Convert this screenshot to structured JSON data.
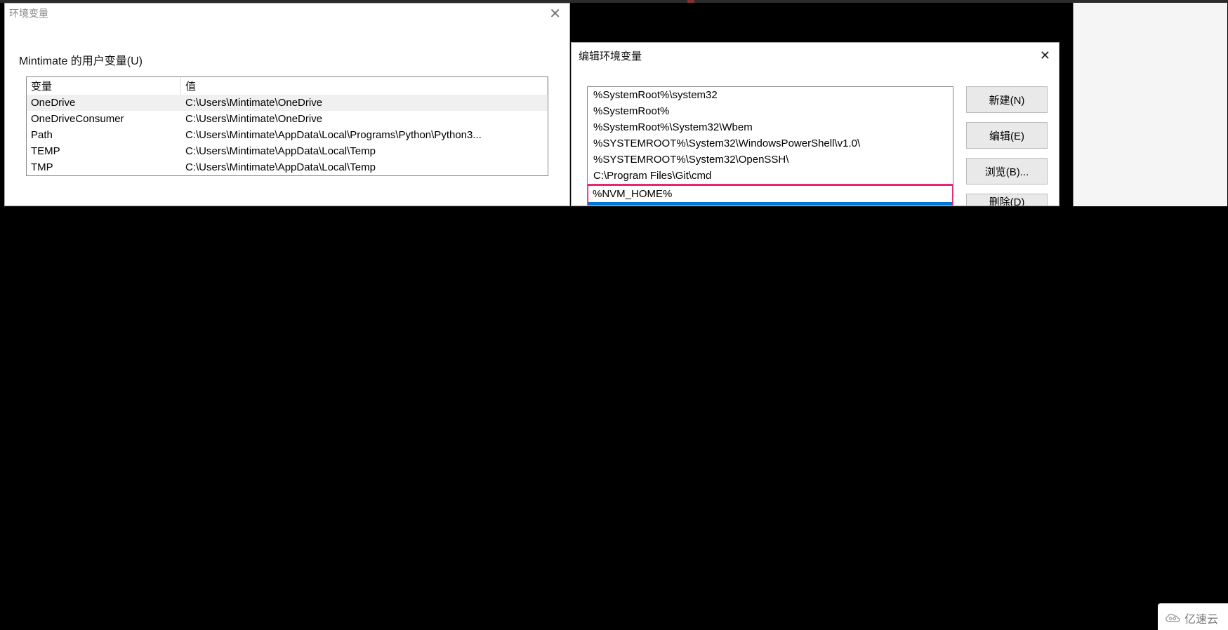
{
  "env_window": {
    "title": "环境变量",
    "section_label": "Mintimate 的用户变量(U)",
    "columns": {
      "var": "变量",
      "val": "值"
    },
    "rows": [
      {
        "name": "OneDrive",
        "value": "C:\\Users\\Mintimate\\OneDrive",
        "selected": true
      },
      {
        "name": "OneDriveConsumer",
        "value": "C:\\Users\\Mintimate\\OneDrive",
        "selected": false
      },
      {
        "name": "Path",
        "value": "C:\\Users\\Mintimate\\AppData\\Local\\Programs\\Python\\Python3...",
        "selected": false
      },
      {
        "name": "TEMP",
        "value": "C:\\Users\\Mintimate\\AppData\\Local\\Temp",
        "selected": false
      },
      {
        "name": "TMP",
        "value": "C:\\Users\\Mintimate\\AppData\\Local\\Temp",
        "selected": false
      }
    ]
  },
  "edit_window": {
    "title": "编辑环境变量",
    "items": [
      "%SystemRoot%\\system32",
      "%SystemRoot%",
      "%SystemRoot%\\System32\\Wbem",
      "%SYSTEMROOT%\\System32\\WindowsPowerShell\\v1.0\\",
      "%SYSTEMROOT%\\System32\\OpenSSH\\",
      "C:\\Program Files\\Git\\cmd"
    ],
    "highlighted_item": "%NVM_HOME%",
    "selected_item_partial": "",
    "buttons": {
      "new": "新建(N)",
      "edit": "编辑(E)",
      "browse": "浏览(B)...",
      "delete": "删除(D)"
    }
  },
  "watermark": "亿速云"
}
